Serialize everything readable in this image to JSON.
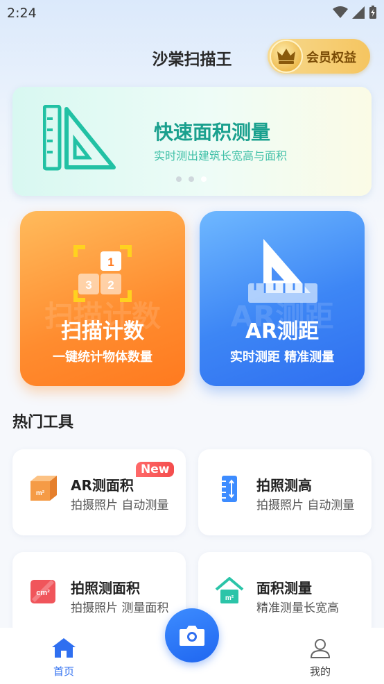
{
  "status_bar": {
    "time": "2:24"
  },
  "header": {
    "title": "沙棠扫描王",
    "vip_label": "会员权益"
  },
  "banner": {
    "title": "快速面积测量",
    "subtitle": "实时测出建筑长宽高与面积",
    "active_dot": 3,
    "dot_count": 3
  },
  "feature_cards": [
    {
      "title": "扫描计数",
      "watermark": "扫描计数",
      "subtitle": "一键统计物体数量",
      "icon_digits": [
        "1",
        "3",
        "2"
      ]
    },
    {
      "title": "AR测距",
      "watermark": "AR测距",
      "subtitle": "实时测距 精准测量"
    }
  ],
  "hot_tools": {
    "heading": "热门工具",
    "items": [
      {
        "name": "AR测面积",
        "desc": "拍摄照片 自动测量",
        "badge": "New",
        "icon": "area-cube-icon",
        "icon_text": "m²"
      },
      {
        "name": "拍照测高",
        "desc": "拍摄照片 自动测量",
        "icon": "height-ruler-icon"
      },
      {
        "name": "拍照测面积",
        "desc": "拍摄照片 测量面积",
        "icon": "photo-area-icon",
        "icon_text": "cm²"
      },
      {
        "name": "面积测量",
        "desc": "精准测量长宽高",
        "icon": "house-area-icon",
        "icon_text": "m²"
      }
    ]
  },
  "tabbar": {
    "home_label": "首页",
    "mine_label": "我的"
  },
  "colors": {
    "accent": "#2f6ff0",
    "orange": "#ff8c2f",
    "teal": "#1aa08e",
    "vip_gold": "#f5c560",
    "badge_red": "#f44c4c"
  }
}
